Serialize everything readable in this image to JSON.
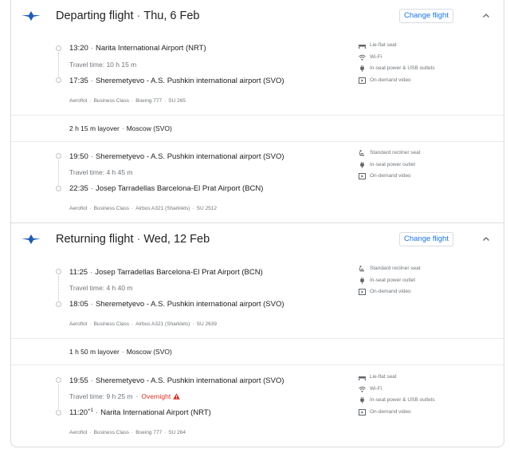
{
  "departing": {
    "title": "Departing flight",
    "date": "Thu, 6 Feb",
    "change_label": "Change flight",
    "legs": [
      {
        "dep_time": "13:20",
        "dep_airport": "Narita International Airport (NRT)",
        "travel_time": "Travel time: 10 h 15 m",
        "arr_time": "17:35",
        "arr_airport": "Sheremetyevo - A.S. Pushkin international airport (SVO)",
        "airline": "Aeroflot",
        "cabin": "Business Class",
        "aircraft": "Boeing 777",
        "flight_no": "SU 265",
        "amenities": [
          {
            "icon": "seat-flat-icon",
            "label": "Lie-flat seat"
          },
          {
            "icon": "wifi-icon",
            "label": "Wi-Fi"
          },
          {
            "icon": "power-plug-icon",
            "label": "In-seat power & USB outlets"
          },
          {
            "icon": "video-icon",
            "label": "On-demand video"
          }
        ]
      },
      {
        "dep_time": "19:50",
        "dep_airport": "Sheremetyevo - A.S. Pushkin international airport (SVO)",
        "travel_time": "Travel time: 4 h 45 m",
        "arr_time": "22:35",
        "arr_airport": "Josep Tarradellas Barcelona-El Prat Airport (BCN)",
        "airline": "Aeroflot",
        "cabin": "Business Class",
        "aircraft": "Airbus A321 (Sharklets)",
        "flight_no": "SU 2512",
        "amenities": [
          {
            "icon": "recliner-seat-icon",
            "label": "Standard recliner seat"
          },
          {
            "icon": "power-plug-icon",
            "label": "In-seat power outlet"
          },
          {
            "icon": "video-icon",
            "label": "On-demand video"
          }
        ]
      }
    ],
    "layover": {
      "duration": "2 h 15 m layover",
      "city": "Moscow (SVO)"
    }
  },
  "returning": {
    "title": "Returning flight",
    "date": "Wed, 12 Feb",
    "change_label": "Change flight",
    "legs": [
      {
        "dep_time": "11:25",
        "dep_airport": "Josep Tarradellas Barcelona-El Prat Airport (BCN)",
        "travel_time": "Travel time: 4 h 40 m",
        "arr_time": "18:05",
        "arr_airport": "Sheremetyevo - A.S. Pushkin international airport (SVO)",
        "airline": "Aeroflot",
        "cabin": "Business Class",
        "aircraft": "Airbus A321 (Sharklets)",
        "flight_no": "SU 2639",
        "amenities": [
          {
            "icon": "recliner-seat-icon",
            "label": "Standard recliner seat"
          },
          {
            "icon": "power-plug-icon",
            "label": "In-seat power outlet"
          },
          {
            "icon": "video-icon",
            "label": "On-demand video"
          }
        ]
      },
      {
        "dep_time": "19:55",
        "dep_airport": "Sheremetyevo - A.S. Pushkin international airport (SVO)",
        "travel_time": "Travel time: 9 h 25 m",
        "overnight": "Overnight",
        "arr_time": "11:20",
        "arr_day_offset": "+1",
        "arr_airport": "Narita International Airport (NRT)",
        "airline": "Aeroflot",
        "cabin": "Business Class",
        "aircraft": "Boeing 777",
        "flight_no": "SU 264",
        "amenities": [
          {
            "icon": "seat-flat-icon",
            "label": "Lie-flat seat"
          },
          {
            "icon": "wifi-icon",
            "label": "Wi-Fi"
          },
          {
            "icon": "power-plug-icon",
            "label": "In-seat power & USB outlets"
          },
          {
            "icon": "video-icon",
            "label": "On-demand video"
          }
        ]
      }
    ],
    "layover": {
      "duration": "1 h 50 m layover",
      "city": "Moscow (SVO)"
    }
  },
  "colors": {
    "link": "#1a73e8",
    "warning": "#d93025",
    "logo": "#1e5bb8"
  }
}
